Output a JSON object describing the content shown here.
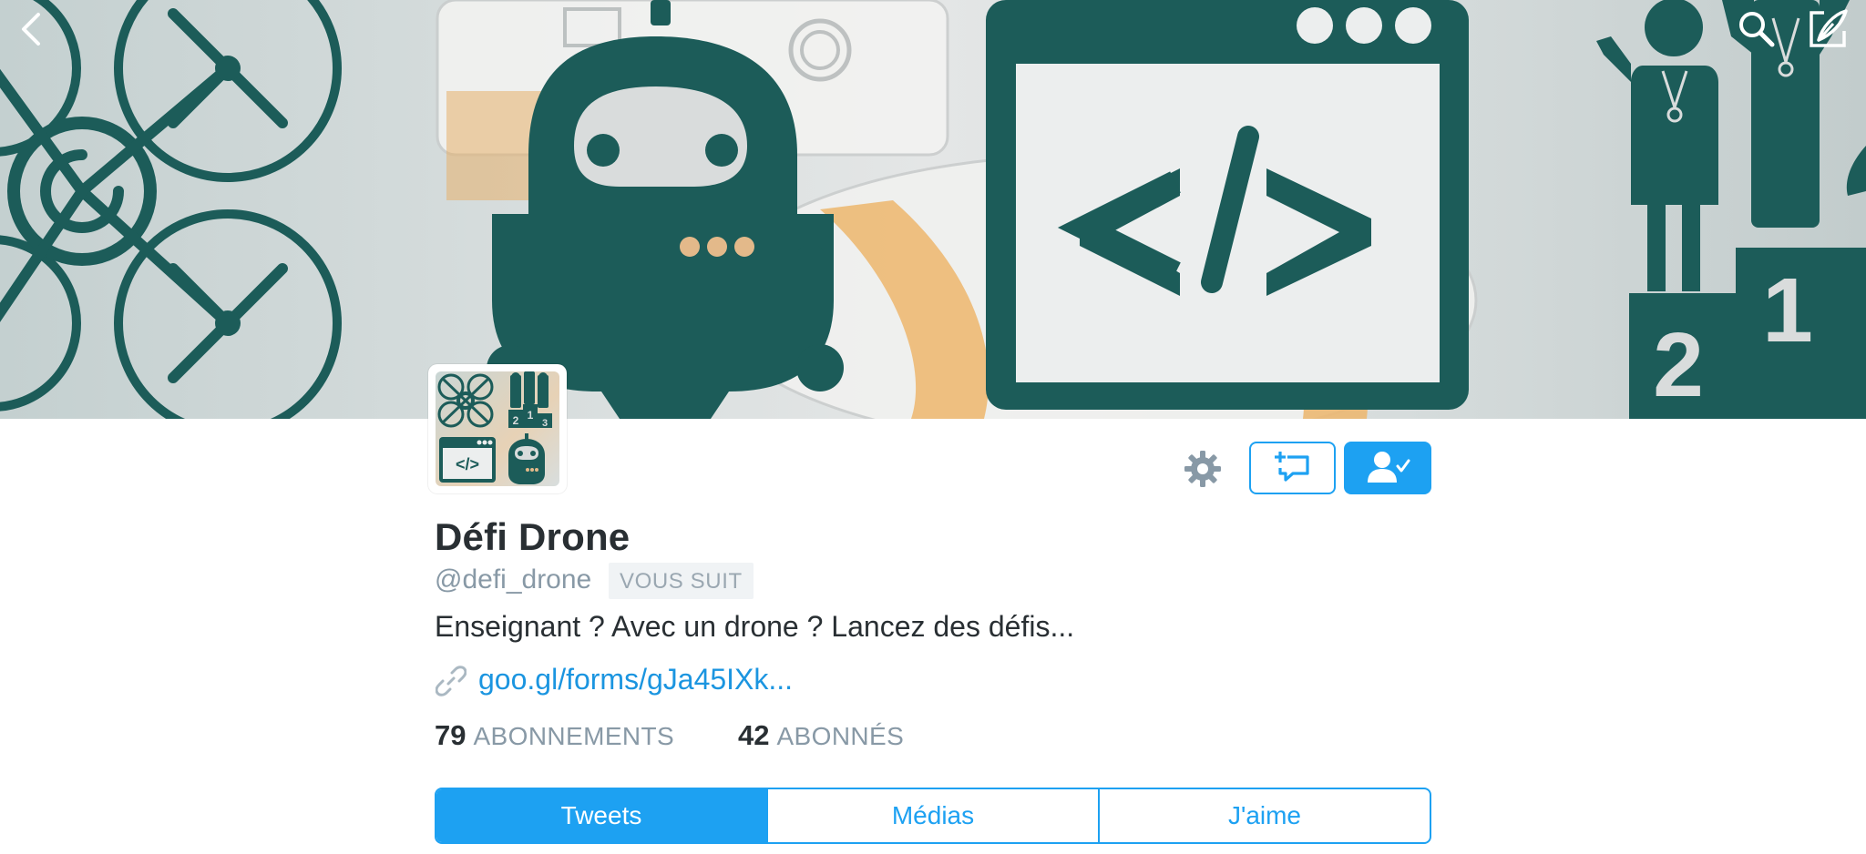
{
  "banner": {
    "numerals": [
      "2",
      "1"
    ]
  },
  "topbar": {
    "back_icon": "chevron-left-icon",
    "search_icon": "search-icon",
    "compose_icon": "compose-icon"
  },
  "avatar": {
    "code_symbol": "</>",
    "podium_numerals": [
      "2",
      "1",
      "3"
    ]
  },
  "actions": {
    "settings_icon": "gear-icon",
    "message_icon": "direct-message-icon",
    "following_icon": "user-following-icon"
  },
  "profile": {
    "display_name": "Défi Drone",
    "handle": "@defi_drone",
    "follows_you": "VOUS SUIT",
    "bio": "Enseignant ? Avec un drone ? Lancez des défis...",
    "website": "goo.gl/forms/gJa45IXk..."
  },
  "stats": {
    "following_count": "79",
    "following_label": "ABONNEMENTS",
    "followers_count": "42",
    "followers_label": "ABONNÉS"
  },
  "tabs": [
    {
      "label": "Tweets",
      "active": true
    },
    {
      "label": "Médias",
      "active": false
    },
    {
      "label": "J'aime",
      "active": false
    }
  ],
  "colors": {
    "accent": "#1da1f2",
    "link": "#1b95e0",
    "banner_icon": "#1c5c59",
    "banner_orange": "#f1b25e",
    "text_primary": "#292f33",
    "text_secondary": "#8899a6"
  }
}
